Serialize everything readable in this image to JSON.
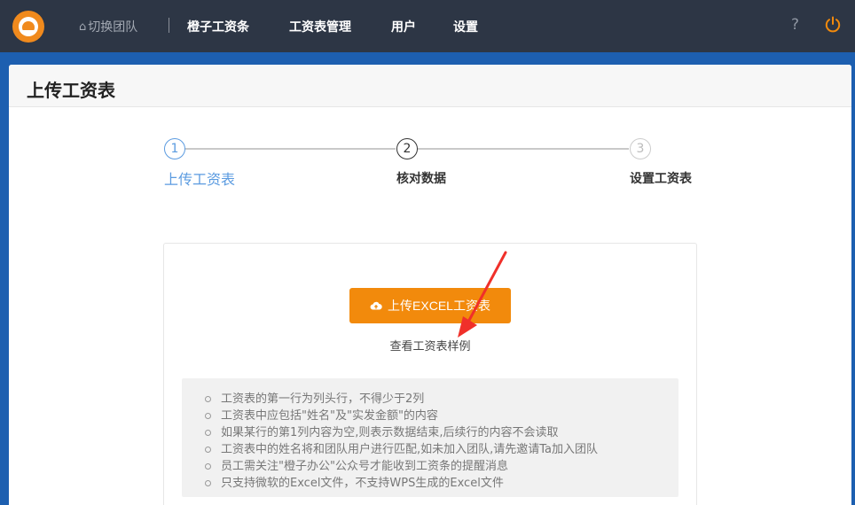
{
  "topbar": {
    "switch_team": "切换团队",
    "nav": [
      "橙子工资条",
      "工资表管理",
      "用户",
      "设置"
    ],
    "help": "?"
  },
  "page": {
    "title": "上传工资表"
  },
  "steps": [
    {
      "number": "1",
      "label": "上传工资表"
    },
    {
      "number": "2",
      "label": "核对数据"
    },
    {
      "number": "3",
      "label": "设置工资表"
    }
  ],
  "upload": {
    "button_label": "上传EXCEL工资表",
    "sample_link": "查看工资表样例"
  },
  "tips": [
    "工资表的第一行为列头行，不得少于2列",
    "工资表中应包括\"姓名\"及\"实发金额\"的内容",
    "如果某行的第1列内容为空,则表示数据结束,后续行的内容不会读取",
    "工资表中的姓名将和团队用户进行匹配,如未加入团队,请先邀请Ta加入团队",
    "员工需关注\"橙子办公\"公众号才能收到工资条的提醒消息",
    "只支持微软的Excel文件，不支持WPS生成的Excel文件"
  ],
  "colors": {
    "topbar": "#2d3645",
    "accent": "#f28a0c",
    "active_step": "#5b9be0",
    "brand_blue": "#1d5fb0"
  }
}
